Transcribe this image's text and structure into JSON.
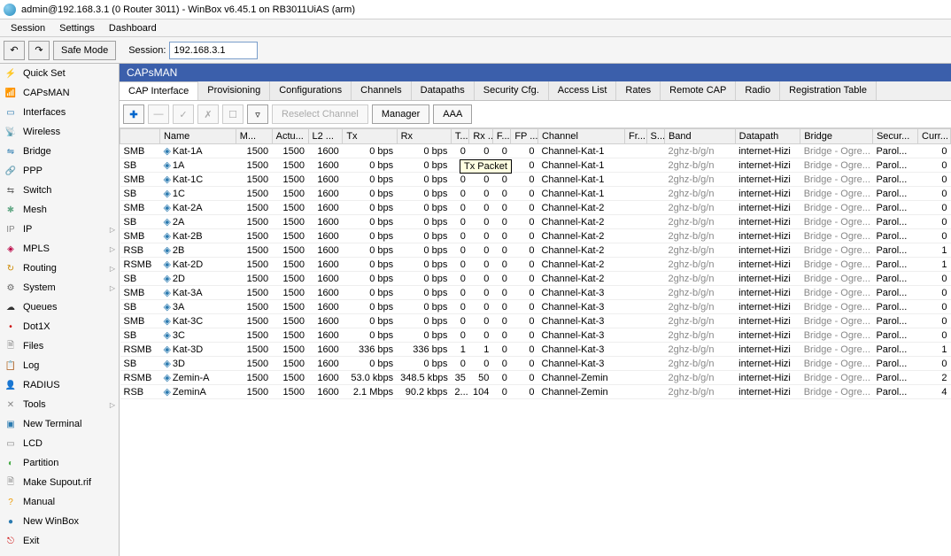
{
  "title": "admin@192.168.3.1 (0 Router 3011) - WinBox v6.45.1 on RB3011UiAS (arm)",
  "menus": [
    "Session",
    "Settings",
    "Dashboard"
  ],
  "toolbar": {
    "undo": "↶",
    "redo": "↷",
    "safemode": "Safe Mode",
    "session_label": "Session:",
    "session_value": "192.168.3.1"
  },
  "sidebar": [
    {
      "icon": "⚡",
      "label": "Quick Set",
      "arrow": false,
      "color": "#d08000"
    },
    {
      "icon": "📶",
      "label": "CAPsMAN",
      "arrow": false,
      "color": "#2a7ab0"
    },
    {
      "icon": "▭",
      "label": "Interfaces",
      "arrow": false,
      "color": "#2a7ab0"
    },
    {
      "icon": "📡",
      "label": "Wireless",
      "arrow": false,
      "color": "#666"
    },
    {
      "icon": "⇋",
      "label": "Bridge",
      "arrow": false,
      "color": "#2a7ab0"
    },
    {
      "icon": "🔗",
      "label": "PPP",
      "arrow": false,
      "color": "#d00"
    },
    {
      "icon": "⇆",
      "label": "Switch",
      "arrow": false,
      "color": "#666"
    },
    {
      "icon": "✱",
      "label": "Mesh",
      "arrow": false,
      "color": "#6a8"
    },
    {
      "icon": "IP",
      "label": "IP",
      "arrow": true,
      "color": "#888"
    },
    {
      "icon": "◈",
      "label": "MPLS",
      "arrow": true,
      "color": "#b04"
    },
    {
      "icon": "↻",
      "label": "Routing",
      "arrow": true,
      "color": "#c80"
    },
    {
      "icon": "⚙",
      "label": "System",
      "arrow": true,
      "color": "#666"
    },
    {
      "icon": "☁",
      "label": "Queues",
      "arrow": false,
      "color": "#333"
    },
    {
      "icon": "•",
      "label": "Dot1X",
      "arrow": false,
      "color": "#c00"
    },
    {
      "icon": "🗎",
      "label": "Files",
      "arrow": false,
      "color": "#888"
    },
    {
      "icon": "📋",
      "label": "Log",
      "arrow": false,
      "color": "#b80"
    },
    {
      "icon": "👤",
      "label": "RADIUS",
      "arrow": false,
      "color": "#c44"
    },
    {
      "icon": "✕",
      "label": "Tools",
      "arrow": true,
      "color": "#888"
    },
    {
      "icon": "▣",
      "label": "New Terminal",
      "arrow": false,
      "color": "#2a7ab0"
    },
    {
      "icon": "▭",
      "label": "LCD",
      "arrow": false,
      "color": "#888"
    },
    {
      "icon": "◐",
      "label": "Partition",
      "arrow": false,
      "color": "#4a4"
    },
    {
      "icon": "🗎",
      "label": "Make Supout.rif",
      "arrow": false,
      "color": "#888"
    },
    {
      "icon": "?",
      "label": "Manual",
      "arrow": false,
      "color": "#e90"
    },
    {
      "icon": "●",
      "label": "New WinBox",
      "arrow": false,
      "color": "#2a7ab0"
    },
    {
      "icon": "⎋",
      "label": "Exit",
      "arrow": false,
      "color": "#c00"
    }
  ],
  "panel": {
    "title": "CAPsMAN",
    "tabs": [
      "CAP Interface",
      "Provisioning",
      "Configurations",
      "Channels",
      "Datapaths",
      "Security Cfg.",
      "Access List",
      "Rates",
      "Remote CAP",
      "Radio",
      "Registration Table"
    ],
    "buttons": {
      "reselect": "Reselect Channel",
      "manager": "Manager",
      "aaa": "AAA"
    },
    "tooltip": "Tx Packet"
  },
  "columns": [
    "",
    "Name",
    "M...",
    "Actu...",
    "L2 ...",
    "Tx",
    "Rx",
    "T...",
    "Rx ...",
    "F...",
    "FP ...",
    "Channel",
    "Fr...",
    "S...",
    "Band",
    "Datapath",
    "Bridge",
    "Secur...",
    "Curr..."
  ],
  "rows": [
    {
      "f": "SMB",
      "n": "Kat-1A",
      "m": 1500,
      "a": 1500,
      "l2": 1600,
      "tx": "0 bps",
      "rx": "0 bps",
      "t": 0,
      "rxn": 0,
      "fn": 0,
      "fp": 0,
      "ch": "Channel-Kat-1",
      "band": "2ghz-b/g/n",
      "dp": "internet-Hizi",
      "br": "Bridge - Ogre...",
      "sec": "Parol...",
      "cur": 0
    },
    {
      "f": "SB",
      "n": "1A",
      "m": 1500,
      "a": 1500,
      "l2": 1600,
      "tx": "0 bps",
      "rx": "0 bps",
      "t": 0,
      "rxn": "",
      "fn": "",
      "fp": 0,
      "ch": "Channel-Kat-1",
      "band": "2ghz-b/g/n",
      "dp": "internet-Hizi",
      "br": "Bridge - Ogre...",
      "sec": "Parol...",
      "cur": 0
    },
    {
      "f": "SMB",
      "n": "Kat-1C",
      "m": 1500,
      "a": 1500,
      "l2": 1600,
      "tx": "0 bps",
      "rx": "0 bps",
      "t": 0,
      "rxn": 0,
      "fn": 0,
      "fp": 0,
      "ch": "Channel-Kat-1",
      "band": "2ghz-b/g/n",
      "dp": "internet-Hizi",
      "br": "Bridge - Ogre...",
      "sec": "Parol...",
      "cur": 0
    },
    {
      "f": "SB",
      "n": "1C",
      "m": 1500,
      "a": 1500,
      "l2": 1600,
      "tx": "0 bps",
      "rx": "0 bps",
      "t": 0,
      "rxn": 0,
      "fn": 0,
      "fp": 0,
      "ch": "Channel-Kat-1",
      "band": "2ghz-b/g/n",
      "dp": "internet-Hizi",
      "br": "Bridge - Ogre...",
      "sec": "Parol...",
      "cur": 0
    },
    {
      "f": "SMB",
      "n": "Kat-2A",
      "m": 1500,
      "a": 1500,
      "l2": 1600,
      "tx": "0 bps",
      "rx": "0 bps",
      "t": 0,
      "rxn": 0,
      "fn": 0,
      "fp": 0,
      "ch": "Channel-Kat-2",
      "band": "2ghz-b/g/n",
      "dp": "internet-Hizi",
      "br": "Bridge - Ogre...",
      "sec": "Parol...",
      "cur": 0
    },
    {
      "f": "SB",
      "n": "2A",
      "m": 1500,
      "a": 1500,
      "l2": 1600,
      "tx": "0 bps",
      "rx": "0 bps",
      "t": 0,
      "rxn": 0,
      "fn": 0,
      "fp": 0,
      "ch": "Channel-Kat-2",
      "band": "2ghz-b/g/n",
      "dp": "internet-Hizi",
      "br": "Bridge - Ogre...",
      "sec": "Parol...",
      "cur": 0
    },
    {
      "f": "SMB",
      "n": "Kat-2B",
      "m": 1500,
      "a": 1500,
      "l2": 1600,
      "tx": "0 bps",
      "rx": "0 bps",
      "t": 0,
      "rxn": 0,
      "fn": 0,
      "fp": 0,
      "ch": "Channel-Kat-2",
      "band": "2ghz-b/g/n",
      "dp": "internet-Hizi",
      "br": "Bridge - Ogre...",
      "sec": "Parol...",
      "cur": 0
    },
    {
      "f": "RSB",
      "n": "2B",
      "m": 1500,
      "a": 1500,
      "l2": 1600,
      "tx": "0 bps",
      "rx": "0 bps",
      "t": 0,
      "rxn": 0,
      "fn": 0,
      "fp": 0,
      "ch": "Channel-Kat-2",
      "band": "2ghz-b/g/n",
      "dp": "internet-Hizi",
      "br": "Bridge - Ogre...",
      "sec": "Parol...",
      "cur": 1
    },
    {
      "f": "RSMB",
      "n": "Kat-2D",
      "m": 1500,
      "a": 1500,
      "l2": 1600,
      "tx": "0 bps",
      "rx": "0 bps",
      "t": 0,
      "rxn": 0,
      "fn": 0,
      "fp": 0,
      "ch": "Channel-Kat-2",
      "band": "2ghz-b/g/n",
      "dp": "internet-Hizi",
      "br": "Bridge - Ogre...",
      "sec": "Parol...",
      "cur": 1
    },
    {
      "f": "SB",
      "n": "2D",
      "m": 1500,
      "a": 1500,
      "l2": 1600,
      "tx": "0 bps",
      "rx": "0 bps",
      "t": 0,
      "rxn": 0,
      "fn": 0,
      "fp": 0,
      "ch": "Channel-Kat-2",
      "band": "2ghz-b/g/n",
      "dp": "internet-Hizi",
      "br": "Bridge - Ogre...",
      "sec": "Parol...",
      "cur": 0
    },
    {
      "f": "SMB",
      "n": "Kat-3A",
      "m": 1500,
      "a": 1500,
      "l2": 1600,
      "tx": "0 bps",
      "rx": "0 bps",
      "t": 0,
      "rxn": 0,
      "fn": 0,
      "fp": 0,
      "ch": "Channel-Kat-3",
      "band": "2ghz-b/g/n",
      "dp": "internet-Hizi",
      "br": "Bridge - Ogre...",
      "sec": "Parol...",
      "cur": 0
    },
    {
      "f": "SB",
      "n": "3A",
      "m": 1500,
      "a": 1500,
      "l2": 1600,
      "tx": "0 bps",
      "rx": "0 bps",
      "t": 0,
      "rxn": 0,
      "fn": 0,
      "fp": 0,
      "ch": "Channel-Kat-3",
      "band": "2ghz-b/g/n",
      "dp": "internet-Hizi",
      "br": "Bridge - Ogre...",
      "sec": "Parol...",
      "cur": 0
    },
    {
      "f": "SMB",
      "n": "Kat-3C",
      "m": 1500,
      "a": 1500,
      "l2": 1600,
      "tx": "0 bps",
      "rx": "0 bps",
      "t": 0,
      "rxn": 0,
      "fn": 0,
      "fp": 0,
      "ch": "Channel-Kat-3",
      "band": "2ghz-b/g/n",
      "dp": "internet-Hizi",
      "br": "Bridge - Ogre...",
      "sec": "Parol...",
      "cur": 0
    },
    {
      "f": "SB",
      "n": "3C",
      "m": 1500,
      "a": 1500,
      "l2": 1600,
      "tx": "0 bps",
      "rx": "0 bps",
      "t": 0,
      "rxn": 0,
      "fn": 0,
      "fp": 0,
      "ch": "Channel-Kat-3",
      "band": "2ghz-b/g/n",
      "dp": "internet-Hizi",
      "br": "Bridge - Ogre...",
      "sec": "Parol...",
      "cur": 0
    },
    {
      "f": "RSMB",
      "n": "Kat-3D",
      "m": 1500,
      "a": 1500,
      "l2": 1600,
      "tx": "336 bps",
      "rx": "336 bps",
      "t": 1,
      "rxn": 1,
      "fn": 0,
      "fp": 0,
      "ch": "Channel-Kat-3",
      "band": "2ghz-b/g/n",
      "dp": "internet-Hizi",
      "br": "Bridge - Ogre...",
      "sec": "Parol...",
      "cur": 1
    },
    {
      "f": "SB",
      "n": "3D",
      "m": 1500,
      "a": 1500,
      "l2": 1600,
      "tx": "0 bps",
      "rx": "0 bps",
      "t": 0,
      "rxn": 0,
      "fn": 0,
      "fp": 0,
      "ch": "Channel-Kat-3",
      "band": "2ghz-b/g/n",
      "dp": "internet-Hizi",
      "br": "Bridge - Ogre...",
      "sec": "Parol...",
      "cur": 0
    },
    {
      "f": "RSMB",
      "n": "Zemin-A",
      "m": 1500,
      "a": 1500,
      "l2": 1600,
      "tx": "53.0 kbps",
      "rx": "348.5 kbps",
      "t": 35,
      "rxn": 50,
      "fn": 0,
      "fp": 0,
      "ch": "Channel-Zemin",
      "band": "2ghz-b/g/n",
      "dp": "internet-Hizi",
      "br": "Bridge - Ogre...",
      "sec": "Parol...",
      "cur": 2
    },
    {
      "f": "RSB",
      "n": "ZeminA",
      "m": 1500,
      "a": 1500,
      "l2": 1600,
      "tx": "2.1 Mbps",
      "rx": "90.2 kbps",
      "t": "2...",
      "rxn": 104,
      "fn": 0,
      "fp": 0,
      "ch": "Channel-Zemin",
      "band": "2ghz-b/g/n",
      "dp": "internet-Hizi",
      "br": "Bridge - Ogre...",
      "sec": "Parol...",
      "cur": 4
    }
  ]
}
